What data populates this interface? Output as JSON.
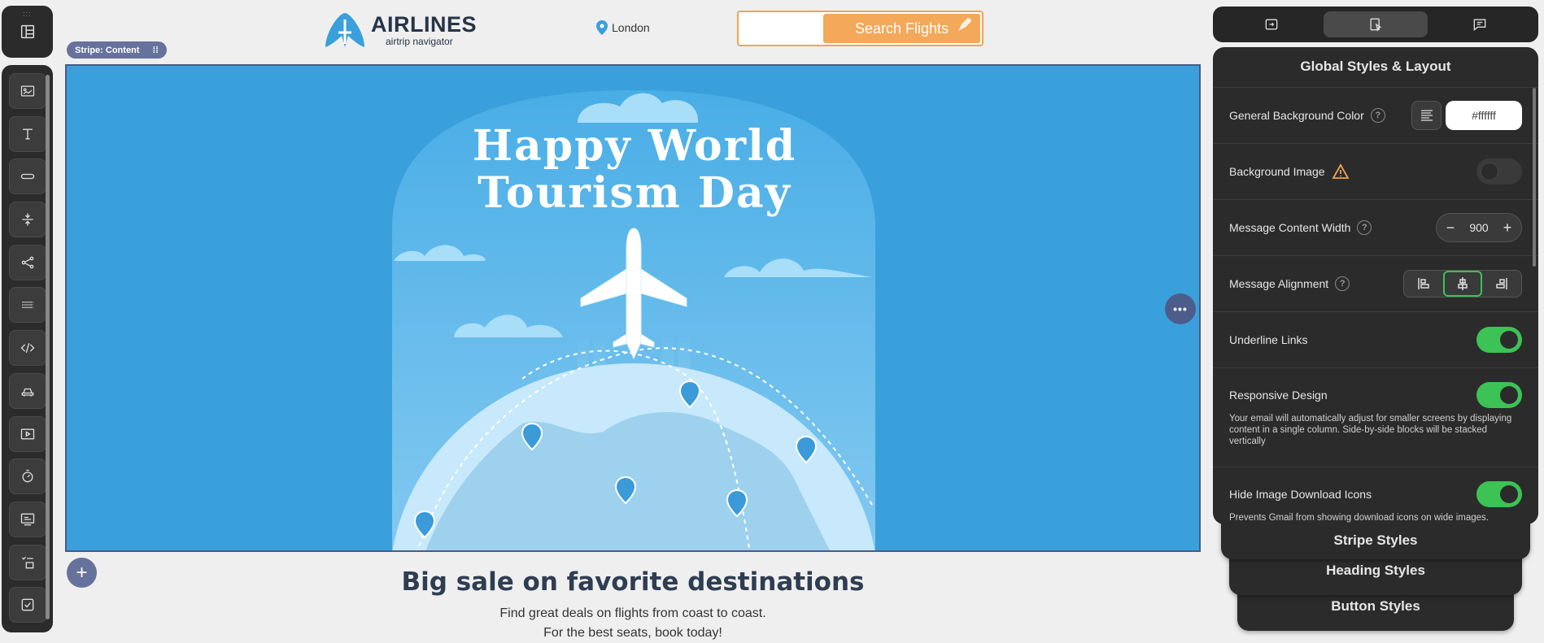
{
  "header": {
    "logo_title": "AIRLINES",
    "logo_subtitle": "airtrip navigator",
    "location": "London",
    "search_button": "Search Flights"
  },
  "stripe_label": "Stripe: Content",
  "banner": {
    "headline_line1": "Happy World",
    "headline_line2": "Tourism Day"
  },
  "promo": {
    "title": "Big sale on favorite destinations",
    "line1": "Find great deals on flights from coast to coast.",
    "line2": "For the best seats, book today!"
  },
  "add_button": "+",
  "more_button": "•••",
  "left_toolbar": {
    "tools": [
      "image-icon",
      "text-icon",
      "button-icon",
      "spacer-icon",
      "social-icon",
      "divider-icon",
      "code-icon",
      "car-icon",
      "video-icon",
      "timer-icon",
      "banner-icon",
      "menu-icon",
      "checkbox-icon"
    ]
  },
  "panel_tabs": [
    "layout-tab",
    "styles-tab",
    "comments-tab"
  ],
  "panel": {
    "title": "Global Styles & Layout",
    "bg_color_label": "General Background Color",
    "bg_color_value": "#ffffff",
    "bg_image_label": "Background Image",
    "bg_image_on": false,
    "content_width_label": "Message Content Width",
    "content_width_value": "900",
    "stepper_minus": "−",
    "stepper_plus": "+",
    "alignment_label": "Message Alignment",
    "underline_label": "Underline Links",
    "underline_on": true,
    "responsive_label": "Responsive Design",
    "responsive_desc": "Your email will automatically adjust for smaller screens by displaying content in a single column. Side-by-side blocks will be stacked vertically",
    "responsive_on": true,
    "hide_icons_label": "Hide Image Download Icons",
    "hide_icons_desc": "Prevents Gmail from showing download icons on wide images.",
    "hide_icons_on": true
  },
  "stacked_panels": {
    "stripe": "Stripe Styles",
    "heading": "Heading Styles",
    "button": "Button Styles"
  },
  "colors": {
    "banner_blue": "#3aa0dc",
    "accent_orange": "#f4a859",
    "toggle_green": "#3cc255",
    "panel_dark": "#2b2b2b"
  }
}
